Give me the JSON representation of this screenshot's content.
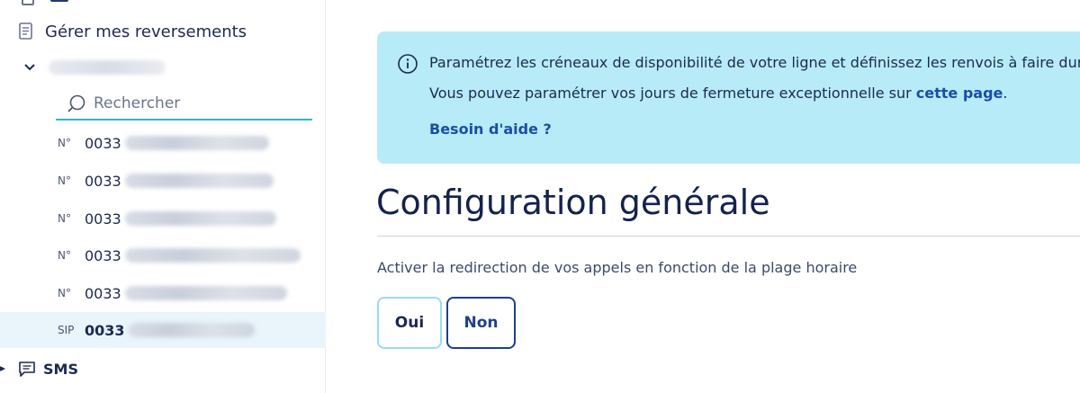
{
  "sidebar": {
    "nav_item": {
      "label": "Gérer mes reversements",
      "icon": "document-icon"
    },
    "search": {
      "placeholder": "Rechercher"
    },
    "lines": [
      {
        "prefix": "N°",
        "number": "0033"
      },
      {
        "prefix": "N°",
        "number": "0033"
      },
      {
        "prefix": "N°",
        "number": "0033"
      },
      {
        "prefix": "N°",
        "number": "0033"
      },
      {
        "prefix": "N°",
        "number": "0033"
      },
      {
        "prefix": "SIP",
        "number": "0033",
        "active": true
      }
    ],
    "sms": {
      "label": "SMS"
    }
  },
  "main": {
    "info": {
      "line1": "Paramétrez les créneaux de disponibilité de votre ligne et définissez les renvois à faire dura",
      "line2_before": "Vous pouvez paramétrer vos jours de fermeture exceptionnelle sur ",
      "line2_link": "cette page",
      "line2_after": ".",
      "help_link": "Besoin d'aide ?"
    },
    "section_title": "Configuration générale",
    "question": "Activer la redirection de vos appels en fonction de la plage horaire",
    "toggle": {
      "yes_label": "Oui",
      "no_label": "Non",
      "selected": "Non"
    }
  },
  "colors": {
    "accent": "#2fb4d2",
    "info_bg": "#b7ebf8",
    "link": "#1a4ea8",
    "primary_text": "#1b2a4e",
    "selected_border": "#1e3f8e",
    "active_row_bg": "#e9f4fb"
  }
}
